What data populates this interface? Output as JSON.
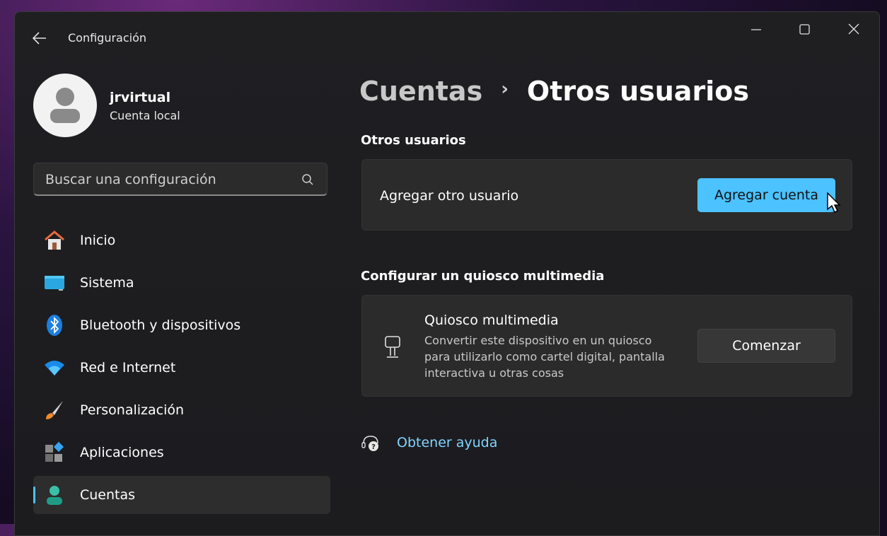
{
  "window": {
    "title": "Configuración"
  },
  "profile": {
    "name": "jrvirtual",
    "account_type": "Cuenta local"
  },
  "search": {
    "placeholder": "Buscar una configuración"
  },
  "sidebar": {
    "items": [
      {
        "label": "Inicio",
        "icon": "home-icon"
      },
      {
        "label": "Sistema",
        "icon": "system-icon"
      },
      {
        "label": "Bluetooth y dispositivos",
        "icon": "bluetooth-icon"
      },
      {
        "label": "Red e Internet",
        "icon": "wifi-icon"
      },
      {
        "label": "Personalización",
        "icon": "brush-icon"
      },
      {
        "label": "Aplicaciones",
        "icon": "apps-icon"
      },
      {
        "label": "Cuentas",
        "icon": "accounts-icon",
        "selected": true
      }
    ]
  },
  "breadcrumb": {
    "parent": "Cuentas",
    "current": "Otros usuarios"
  },
  "other_users": {
    "section_title": "Otros usuarios",
    "row_label": "Agregar otro usuario",
    "button_label": "Agregar cuenta"
  },
  "kiosk": {
    "section_title": "Configurar un quiosco multimedia",
    "title": "Quiosco multimedia",
    "description": "Convertir este dispositivo en un quiosco para utilizarlo como cartel digital, pantalla interactiva u otras cosas",
    "button_label": "Comenzar"
  },
  "help": {
    "label": "Obtener ayuda"
  },
  "colors": {
    "accent": "#4cc2ff",
    "window_bg": "#202020",
    "card_bg": "#2b2b2b",
    "link": "#82d4ff"
  }
}
